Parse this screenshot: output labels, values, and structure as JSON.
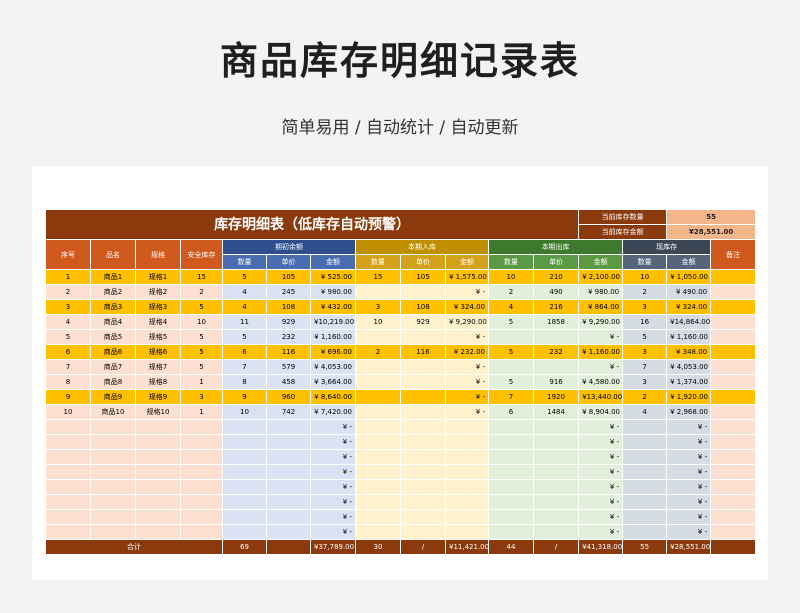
{
  "page": {
    "title": "商品库存明细记录表",
    "subtitle": "简单易用 / 自动统计 / 自动更新"
  },
  "sheet": {
    "title": "库存明细表（低库存自动预警）",
    "current_qty_label": "当前库存数量",
    "current_qty_value": "55",
    "current_amt_label": "当前库存金额",
    "current_amt_value": "¥28,551.00",
    "headers": {
      "seq": "序号",
      "name": "品名",
      "spec": "规格",
      "safe": "安全库存",
      "opening": "期初余额",
      "in": "本期入库",
      "out": "本期出库",
      "current": "现库存",
      "remark": "备注",
      "qty": "数量",
      "price": "单价",
      "amount": "金额"
    },
    "rows": [
      {
        "seq": "1",
        "name": "商品1",
        "spec": "规格1",
        "safe": "15",
        "o_qty": "5",
        "o_price": "105",
        "o_amt": "¥   525.00",
        "i_qty": "15",
        "i_price": "105",
        "i_amt": "¥  1,575.00",
        "u_qty": "10",
        "u_price": "210",
        "u_amt": "¥  2,100.00",
        "c_qty": "10",
        "c_amt": "¥  1,050.00",
        "warn": true
      },
      {
        "seq": "2",
        "name": "商品2",
        "spec": "规格2",
        "safe": "2",
        "o_qty": "4",
        "o_price": "245",
        "o_amt": "¥   980.00",
        "i_qty": "",
        "i_price": "",
        "i_amt": "¥      -",
        "u_qty": "2",
        "u_price": "490",
        "u_amt": "¥    980.00",
        "c_qty": "2",
        "c_amt": "¥    490.00",
        "warn": false
      },
      {
        "seq": "3",
        "name": "商品3",
        "spec": "规格3",
        "safe": "5",
        "o_qty": "4",
        "o_price": "108",
        "o_amt": "¥   432.00",
        "i_qty": "3",
        "i_price": "108",
        "i_amt": "¥    324.00",
        "u_qty": "4",
        "u_price": "216",
        "u_amt": "¥    864.00",
        "c_qty": "3",
        "c_amt": "¥    324.00",
        "warn": true
      },
      {
        "seq": "4",
        "name": "商品4",
        "spec": "规格4",
        "safe": "10",
        "o_qty": "11",
        "o_price": "929",
        "o_amt": "¥10,219.00",
        "i_qty": "10",
        "i_price": "929",
        "i_amt": "¥  9,290.00",
        "u_qty": "5",
        "u_price": "1858",
        "u_amt": "¥  9,290.00",
        "c_qty": "16",
        "c_amt": "¥14,864.00",
        "warn": false
      },
      {
        "seq": "5",
        "name": "商品5",
        "spec": "规格5",
        "safe": "5",
        "o_qty": "5",
        "o_price": "232",
        "o_amt": "¥ 1,160.00",
        "i_qty": "",
        "i_price": "",
        "i_amt": "¥      -",
        "u_qty": "",
        "u_price": "",
        "u_amt": "¥      -",
        "c_qty": "5",
        "c_amt": "¥  1,160.00",
        "warn": false
      },
      {
        "seq": "6",
        "name": "商品6",
        "spec": "规格6",
        "safe": "5",
        "o_qty": "6",
        "o_price": "116",
        "o_amt": "¥   696.00",
        "i_qty": "2",
        "i_price": "116",
        "i_amt": "¥    232.00",
        "u_qty": "5",
        "u_price": "232",
        "u_amt": "¥  1,160.00",
        "c_qty": "3",
        "c_amt": "¥    348.00",
        "warn": true
      },
      {
        "seq": "7",
        "name": "商品7",
        "spec": "规格7",
        "safe": "5",
        "o_qty": "7",
        "o_price": "579",
        "o_amt": "¥ 4,053.00",
        "i_qty": "",
        "i_price": "",
        "i_amt": "¥      -",
        "u_qty": "",
        "u_price": "",
        "u_amt": "¥      -",
        "c_qty": "7",
        "c_amt": "¥  4,053.00",
        "warn": false
      },
      {
        "seq": "8",
        "name": "商品8",
        "spec": "规格8",
        "safe": "1",
        "o_qty": "8",
        "o_price": "458",
        "o_amt": "¥ 3,664.00",
        "i_qty": "",
        "i_price": "",
        "i_amt": "¥      -",
        "u_qty": "5",
        "u_price": "916",
        "u_amt": "¥  4,580.00",
        "c_qty": "3",
        "c_amt": "¥  1,374.00",
        "warn": false
      },
      {
        "seq": "9",
        "name": "商品9",
        "spec": "规格9",
        "safe": "3",
        "o_qty": "9",
        "o_price": "960",
        "o_amt": "¥ 8,640.00",
        "i_qty": "",
        "i_price": "",
        "i_amt": "¥      -",
        "u_qty": "7",
        "u_price": "1920",
        "u_amt": "¥13,440.00",
        "c_qty": "2",
        "c_amt": "¥  1,920.00",
        "warn": true
      },
      {
        "seq": "10",
        "name": "商品10",
        "spec": "规格10",
        "safe": "1",
        "o_qty": "10",
        "o_price": "742",
        "o_amt": "¥ 7,420.00",
        "i_qty": "",
        "i_price": "",
        "i_amt": "¥      -",
        "u_qty": "6",
        "u_price": "1484",
        "u_amt": "¥  8,904.00",
        "c_qty": "4",
        "c_amt": "¥  2,968.00",
        "warn": false
      }
    ],
    "empty_amount": "¥      -",
    "empty_rows": 8,
    "total": {
      "label": "合计",
      "o_qty": "69",
      "o_amt": "¥37,789.00",
      "i_qty": "30",
      "i_price": "/",
      "i_amt": "¥11,421.00",
      "u_qty": "44",
      "u_price": "/",
      "u_amt": "¥41,318.00",
      "c_qty": "55",
      "c_amt": "¥28,551.00"
    }
  },
  "colors": {
    "brown_header": "#8a3a0c",
    "warning_row": "#ffc000",
    "opening": "#2f4e8e",
    "in": "#bf8f00",
    "out": "#3d7a2e",
    "current": "#3b4756"
  }
}
